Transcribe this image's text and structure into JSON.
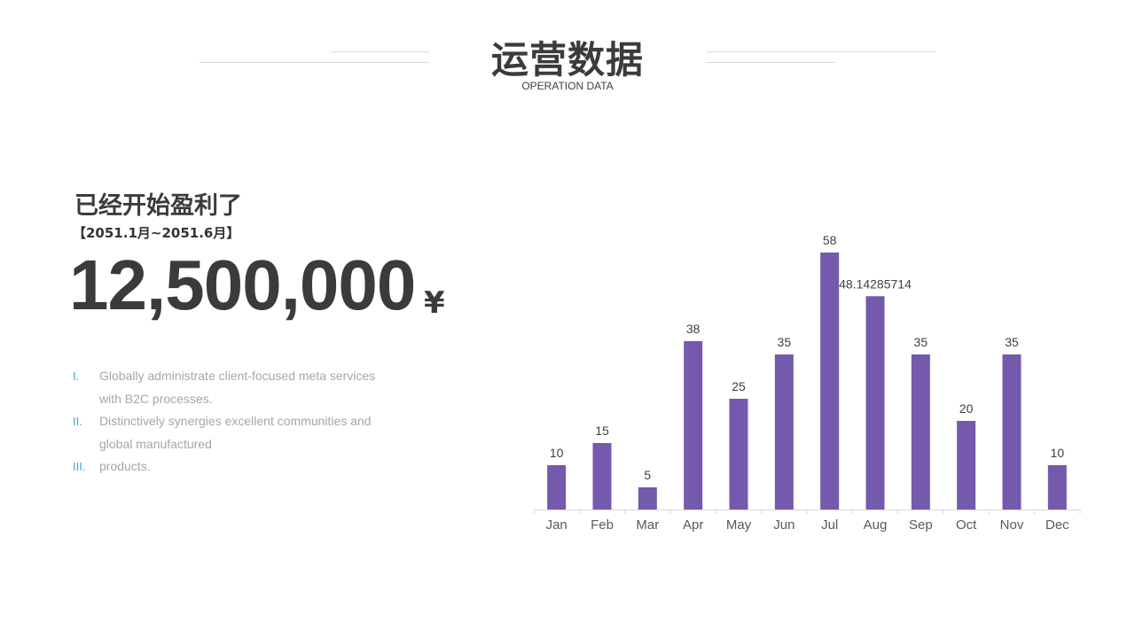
{
  "header": {
    "title": "运营数据",
    "subtitle": "OPERATION DATA"
  },
  "summary": {
    "headline": "已经开始盈利了",
    "period": "【2051.1月~2051.6月】",
    "amount": "12,500,000",
    "currency": "¥"
  },
  "notes": [
    {
      "num": "I.",
      "text": "Globally administrate client-focused meta services with B2C processes."
    },
    {
      "num": "II.",
      "text": "Distinctively synergies excellent communities and global manufactured"
    },
    {
      "num": "III.",
      "text": "products."
    }
  ],
  "colors": {
    "bar": "#7459ad",
    "accent": "#3aa7d8",
    "text_dark": "#3b3b3b",
    "text_muted": "#a6a6a6"
  },
  "chart_data": {
    "type": "bar",
    "categories": [
      "Jan",
      "Feb",
      "Mar",
      "Apr",
      "May",
      "Jun",
      "Jul",
      "Aug",
      "Sep",
      "Oct",
      "Nov",
      "Dec"
    ],
    "series": [
      {
        "values": [
          10,
          15,
          5,
          38,
          25,
          35,
          58,
          48.14285714,
          35,
          20,
          35,
          10
        ]
      }
    ],
    "data_labels": [
      "10",
      "15",
      "5",
      "38",
      "25",
      "35",
      "58",
      "48.14285714",
      "35",
      "20",
      "35",
      "10"
    ],
    "ylim": [
      0,
      60
    ],
    "grid": false,
    "legend": "none",
    "title": "",
    "xlabel": "",
    "ylabel": ""
  }
}
